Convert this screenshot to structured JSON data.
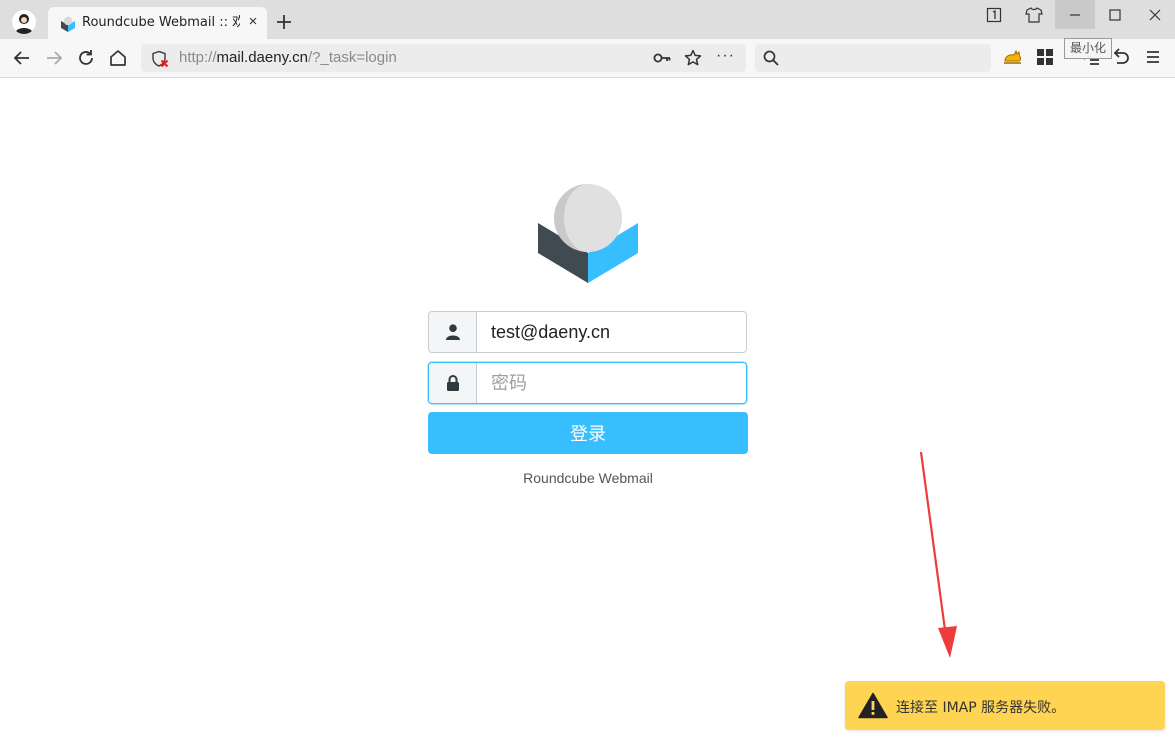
{
  "browser": {
    "tab": {
      "title": "Roundcube Webmail :: 欢迎",
      "close_glyph": "×"
    },
    "tooltip": "最小化",
    "address_bar": {
      "prefix": "http://",
      "host": "mail.daeny.cn",
      "path": "/?_task=login",
      "more_glyph": "···"
    },
    "search_placeholder": ""
  },
  "login": {
    "username_value": "test@daeny.cn",
    "password_placeholder": "密码",
    "submit_label": "登录",
    "product_name": "Roundcube Webmail"
  },
  "notification": {
    "message": "连接至 IMAP 服务器失败。",
    "type": "warning"
  },
  "colors": {
    "accent": "#37beff",
    "warning": "#ffd452",
    "annotation_arrow": "#ee3b3b"
  }
}
